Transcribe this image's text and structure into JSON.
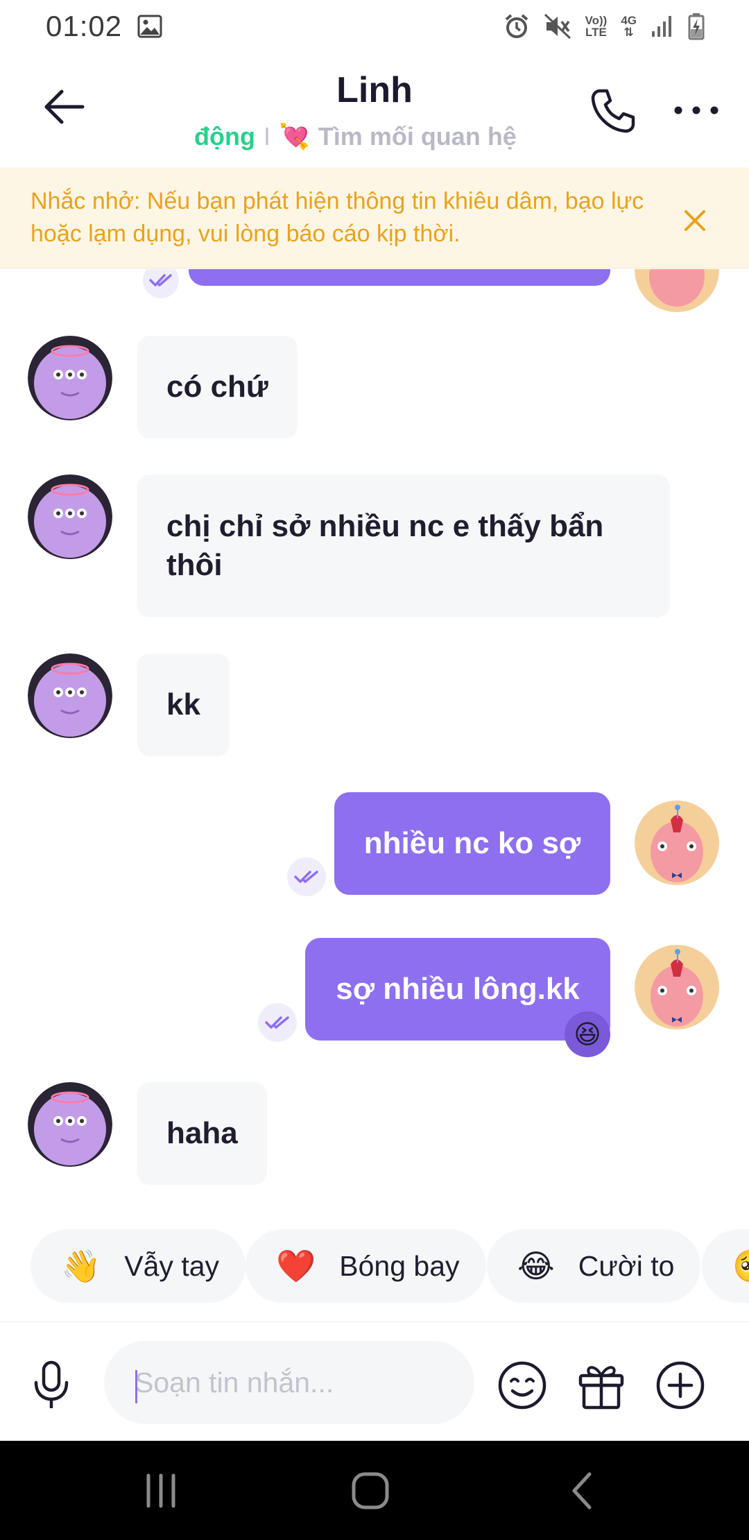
{
  "status_bar": {
    "time": "01:02",
    "icons": [
      "image-icon",
      "alarm-icon",
      "mute-icon",
      "volte-icon",
      "4g-icon",
      "signal-icon",
      "battery-charging-icon"
    ],
    "volte_label_1": "Vo))",
    "volte_label_2": "LTE",
    "net_label": "4G"
  },
  "header": {
    "contact_name": "Linh",
    "activity_status": "động",
    "separator": "I",
    "heart_emoji": "💘",
    "relationship_goal": "Tìm mối quan hệ"
  },
  "reminder": {
    "text": "Nhắc nhở: Nếu bạn phát hiện thông tin khiêu dâm, bạo lực hoặc lạm dụng, vui lòng báo cáo kịp thời."
  },
  "messages": [
    {
      "direction": "incoming",
      "text": "có chứ"
    },
    {
      "direction": "incoming",
      "text": "chị chỉ sở nhiều nc e thấy bẩn thôi"
    },
    {
      "direction": "incoming",
      "text": "kk"
    },
    {
      "direction": "outgoing",
      "text": "nhiều nc ko sợ",
      "status": "read"
    },
    {
      "direction": "outgoing",
      "text": "sợ nhiều lông.kk",
      "status": "read",
      "reaction": "😆"
    },
    {
      "direction": "incoming",
      "text": "haha"
    }
  ],
  "quick_reactions": [
    {
      "emoji": "👋",
      "label": "Vẫy tay"
    },
    {
      "emoji": "❤️",
      "label": "Bóng bay"
    },
    {
      "emoji": "😂",
      "label": "Cười to"
    },
    {
      "emoji": "🥺",
      "label": ""
    }
  ],
  "composer": {
    "placeholder": "Soạn tin nhắn...",
    "value": ""
  },
  "colors": {
    "accent": "#8d6ff0",
    "incoming_bubble": "#f6f7f9",
    "reminder_bg": "#fef6e4",
    "reminder_text": "#e9a21f",
    "online_green": "#27d08b"
  }
}
